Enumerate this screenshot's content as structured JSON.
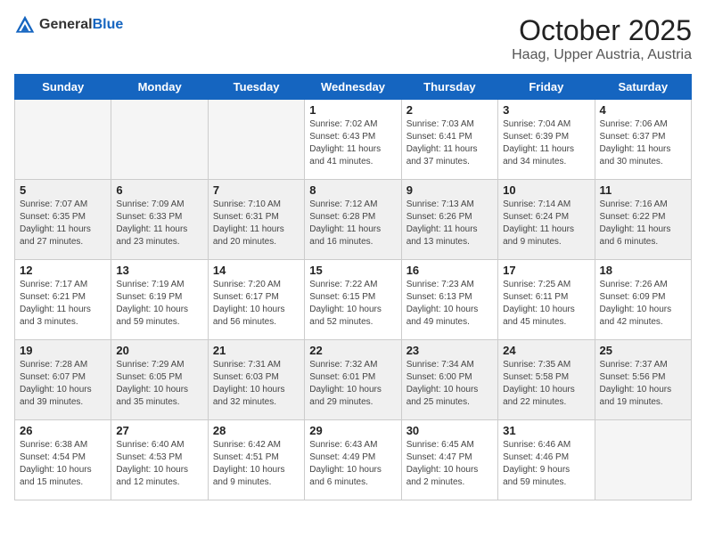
{
  "header": {
    "logo_general": "General",
    "logo_blue": "Blue",
    "month_title": "October 2025",
    "location": "Haag, Upper Austria, Austria"
  },
  "days_of_week": [
    "Sunday",
    "Monday",
    "Tuesday",
    "Wednesday",
    "Thursday",
    "Friday",
    "Saturday"
  ],
  "weeks": [
    [
      {
        "day": "",
        "info": "",
        "empty": true
      },
      {
        "day": "",
        "info": "",
        "empty": true
      },
      {
        "day": "",
        "info": "",
        "empty": true
      },
      {
        "day": "1",
        "info": "Sunrise: 7:02 AM\nSunset: 6:43 PM\nDaylight: 11 hours\nand 41 minutes."
      },
      {
        "day": "2",
        "info": "Sunrise: 7:03 AM\nSunset: 6:41 PM\nDaylight: 11 hours\nand 37 minutes."
      },
      {
        "day": "3",
        "info": "Sunrise: 7:04 AM\nSunset: 6:39 PM\nDaylight: 11 hours\nand 34 minutes."
      },
      {
        "day": "4",
        "info": "Sunrise: 7:06 AM\nSunset: 6:37 PM\nDaylight: 11 hours\nand 30 minutes."
      }
    ],
    [
      {
        "day": "5",
        "info": "Sunrise: 7:07 AM\nSunset: 6:35 PM\nDaylight: 11 hours\nand 27 minutes.",
        "shaded": true
      },
      {
        "day": "6",
        "info": "Sunrise: 7:09 AM\nSunset: 6:33 PM\nDaylight: 11 hours\nand 23 minutes.",
        "shaded": true
      },
      {
        "day": "7",
        "info": "Sunrise: 7:10 AM\nSunset: 6:31 PM\nDaylight: 11 hours\nand 20 minutes.",
        "shaded": true
      },
      {
        "day": "8",
        "info": "Sunrise: 7:12 AM\nSunset: 6:28 PM\nDaylight: 11 hours\nand 16 minutes.",
        "shaded": true
      },
      {
        "day": "9",
        "info": "Sunrise: 7:13 AM\nSunset: 6:26 PM\nDaylight: 11 hours\nand 13 minutes.",
        "shaded": true
      },
      {
        "day": "10",
        "info": "Sunrise: 7:14 AM\nSunset: 6:24 PM\nDaylight: 11 hours\nand 9 minutes.",
        "shaded": true
      },
      {
        "day": "11",
        "info": "Sunrise: 7:16 AM\nSunset: 6:22 PM\nDaylight: 11 hours\nand 6 minutes.",
        "shaded": true
      }
    ],
    [
      {
        "day": "12",
        "info": "Sunrise: 7:17 AM\nSunset: 6:21 PM\nDaylight: 11 hours\nand 3 minutes."
      },
      {
        "day": "13",
        "info": "Sunrise: 7:19 AM\nSunset: 6:19 PM\nDaylight: 10 hours\nand 59 minutes."
      },
      {
        "day": "14",
        "info": "Sunrise: 7:20 AM\nSunset: 6:17 PM\nDaylight: 10 hours\nand 56 minutes."
      },
      {
        "day": "15",
        "info": "Sunrise: 7:22 AM\nSunset: 6:15 PM\nDaylight: 10 hours\nand 52 minutes."
      },
      {
        "day": "16",
        "info": "Sunrise: 7:23 AM\nSunset: 6:13 PM\nDaylight: 10 hours\nand 49 minutes."
      },
      {
        "day": "17",
        "info": "Sunrise: 7:25 AM\nSunset: 6:11 PM\nDaylight: 10 hours\nand 45 minutes."
      },
      {
        "day": "18",
        "info": "Sunrise: 7:26 AM\nSunset: 6:09 PM\nDaylight: 10 hours\nand 42 minutes."
      }
    ],
    [
      {
        "day": "19",
        "info": "Sunrise: 7:28 AM\nSunset: 6:07 PM\nDaylight: 10 hours\nand 39 minutes.",
        "shaded": true
      },
      {
        "day": "20",
        "info": "Sunrise: 7:29 AM\nSunset: 6:05 PM\nDaylight: 10 hours\nand 35 minutes.",
        "shaded": true
      },
      {
        "day": "21",
        "info": "Sunrise: 7:31 AM\nSunset: 6:03 PM\nDaylight: 10 hours\nand 32 minutes.",
        "shaded": true
      },
      {
        "day": "22",
        "info": "Sunrise: 7:32 AM\nSunset: 6:01 PM\nDaylight: 10 hours\nand 29 minutes.",
        "shaded": true
      },
      {
        "day": "23",
        "info": "Sunrise: 7:34 AM\nSunset: 6:00 PM\nDaylight: 10 hours\nand 25 minutes.",
        "shaded": true
      },
      {
        "day": "24",
        "info": "Sunrise: 7:35 AM\nSunset: 5:58 PM\nDaylight: 10 hours\nand 22 minutes.",
        "shaded": true
      },
      {
        "day": "25",
        "info": "Sunrise: 7:37 AM\nSunset: 5:56 PM\nDaylight: 10 hours\nand 19 minutes.",
        "shaded": true
      }
    ],
    [
      {
        "day": "26",
        "info": "Sunrise: 6:38 AM\nSunset: 4:54 PM\nDaylight: 10 hours\nand 15 minutes."
      },
      {
        "day": "27",
        "info": "Sunrise: 6:40 AM\nSunset: 4:53 PM\nDaylight: 10 hours\nand 12 minutes."
      },
      {
        "day": "28",
        "info": "Sunrise: 6:42 AM\nSunset: 4:51 PM\nDaylight: 10 hours\nand 9 minutes."
      },
      {
        "day": "29",
        "info": "Sunrise: 6:43 AM\nSunset: 4:49 PM\nDaylight: 10 hours\nand 6 minutes."
      },
      {
        "day": "30",
        "info": "Sunrise: 6:45 AM\nSunset: 4:47 PM\nDaylight: 10 hours\nand 2 minutes."
      },
      {
        "day": "31",
        "info": "Sunrise: 6:46 AM\nSunset: 4:46 PM\nDaylight: 9 hours\nand 59 minutes."
      },
      {
        "day": "",
        "info": "",
        "empty": true
      }
    ]
  ]
}
